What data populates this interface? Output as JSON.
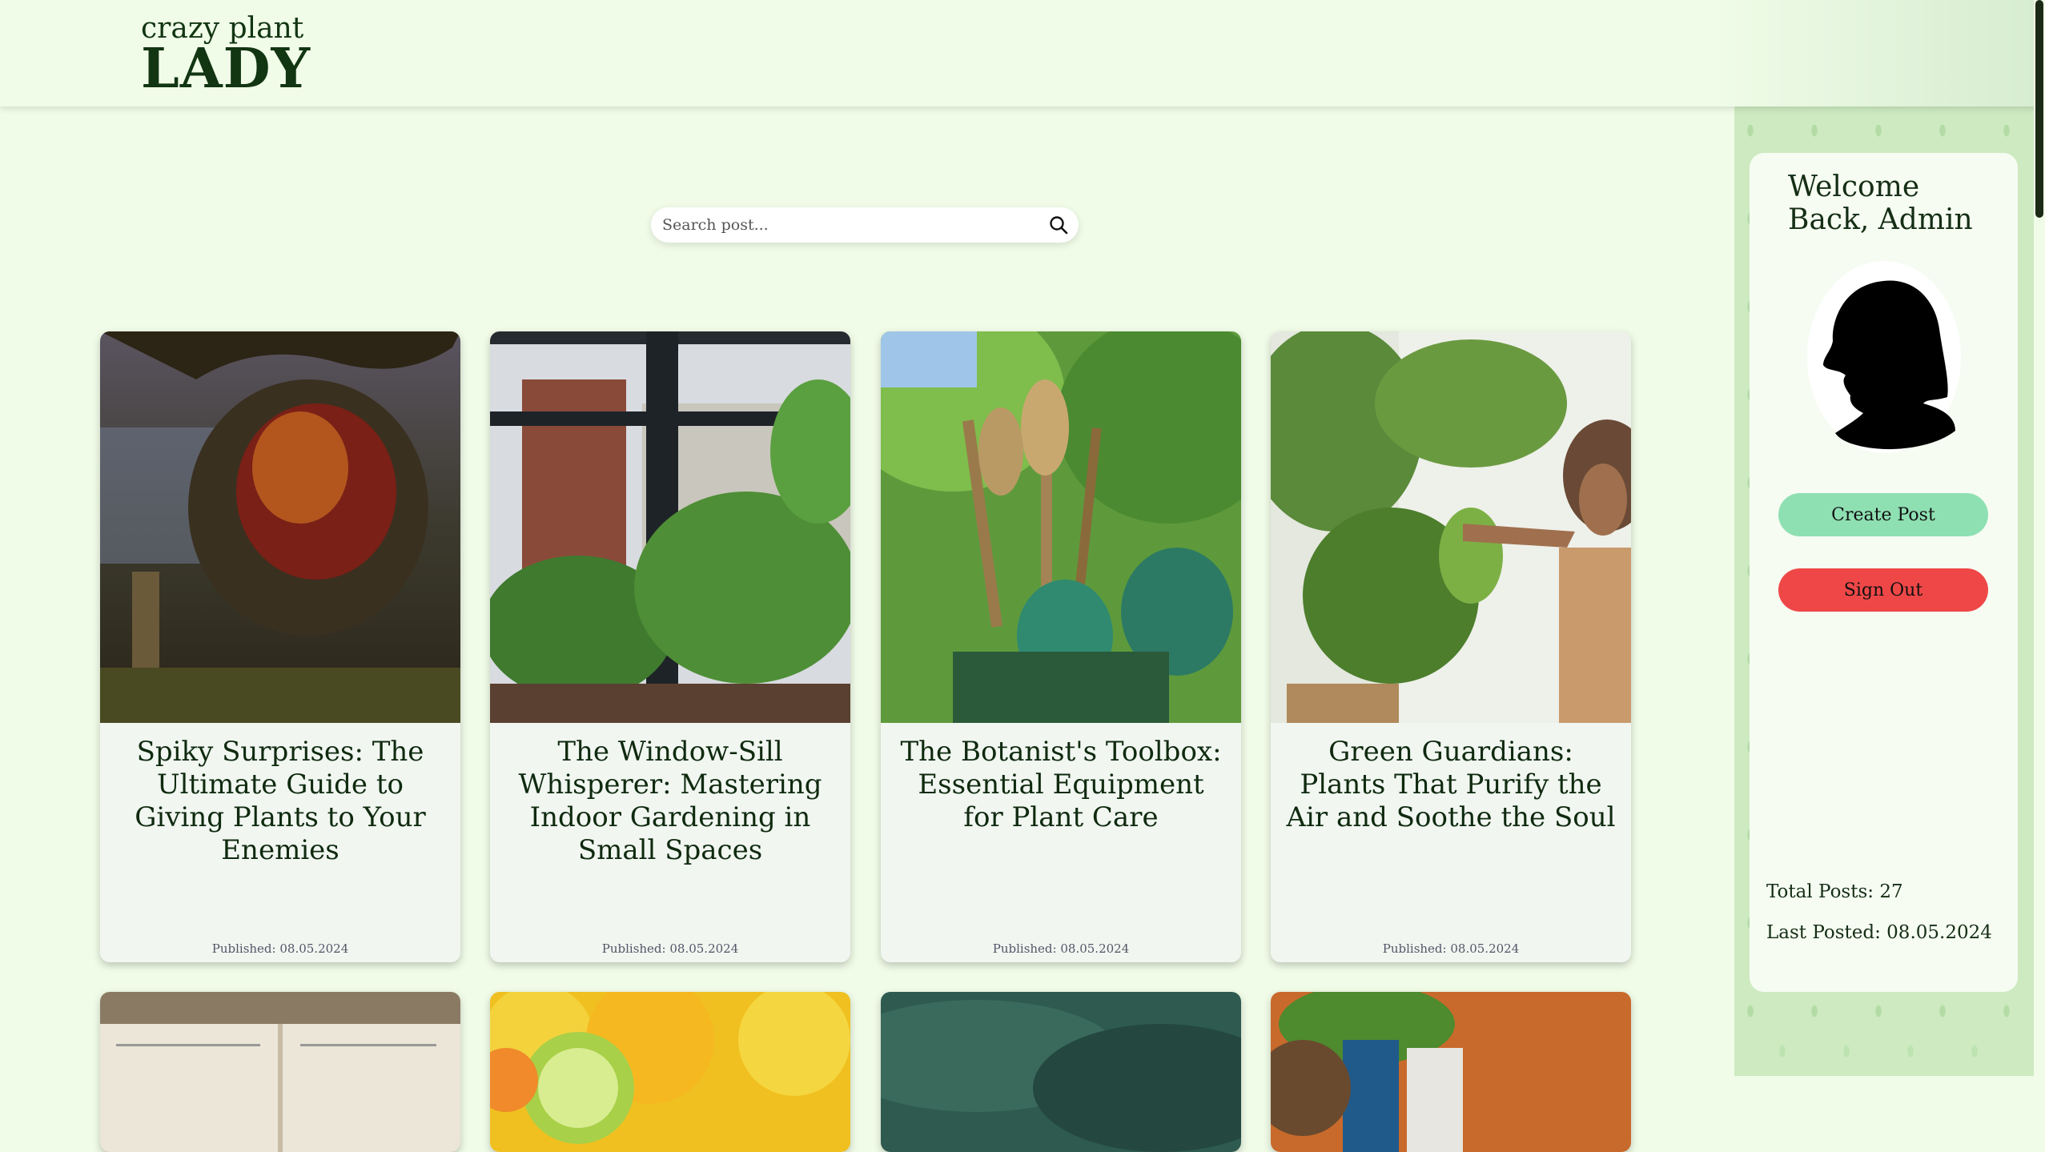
{
  "header": {
    "logo_small": "crazy plant",
    "logo_big": "LADY"
  },
  "search": {
    "placeholder": "Search post..."
  },
  "posts": [
    {
      "title": "Spiky Surprises: The Ultimate Guide to Giving Plants to Your Enemies",
      "date": "Published: 08.05.2024"
    },
    {
      "title": "The Window-Sill Whisperer: Mastering Indoor Gardening in Small Spaces",
      "date": "Published: 08.05.2024"
    },
    {
      "title": "The Botanist's Toolbox: Essential Equipment for Plant Care",
      "date": "Published: 08.05.2024"
    },
    {
      "title": "Green Guardians: Plants That Purify the Air and Soothe the Soul",
      "date": "Published: 08.05.2024"
    }
  ],
  "sidebar": {
    "welcome": "Welcome Back, Admin",
    "create_label": "Create Post",
    "signout_label": "Sign Out",
    "total_posts": "Total Posts: 27",
    "last_posted": "Last Posted: 08.05.2024"
  },
  "colors": {
    "background": "#f0fce8",
    "create_button": "#8ee0b3",
    "signout_button": "#ef4747",
    "text": "#0f2a0f"
  }
}
